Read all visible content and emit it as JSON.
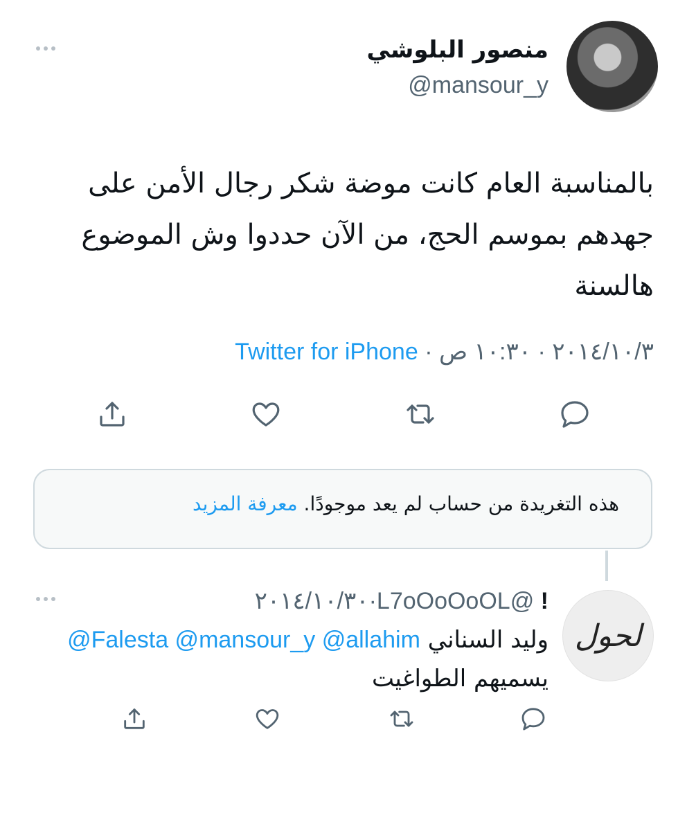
{
  "tweet": {
    "display_name": "منصور البلوشي",
    "handle": "@mansour_y",
    "text_lines": [
      "بالمناسبة العام كانت موضة شكر رجال الأمن على",
      "جهدهم بموسم الحج، من الآن حددوا وش الموضوع",
      "هالسنة"
    ],
    "date": "٢٠١٤/١٠/٣",
    "time": "١٠:٣٠ ص",
    "separator": "·",
    "source": "Twitter for iPhone",
    "actions": [
      "reply-icon",
      "retweet-icon",
      "like-icon",
      "share-icon"
    ]
  },
  "notice": {
    "text": "هذه التغريدة من حساب لم يعد موجودًا.",
    "learn_more": "معرفة المزيد"
  },
  "reply": {
    "badge": "!",
    "handle": "@L7oOoOoOL",
    "separator": "·",
    "date": "٢٠١٤/١٠/٣٠",
    "avatar_text": "لحول",
    "mentions": "@Falesta @mansour_y @allahim",
    "text_line1": "وليد السناني",
    "text_line2": "يسميهم الطواغيت",
    "actions": [
      "reply-icon",
      "retweet-icon",
      "like-icon",
      "share-icon"
    ]
  },
  "colors": {
    "accent": "#1d9bf0",
    "secondary_text": "#536471",
    "border": "#cfd9de"
  }
}
